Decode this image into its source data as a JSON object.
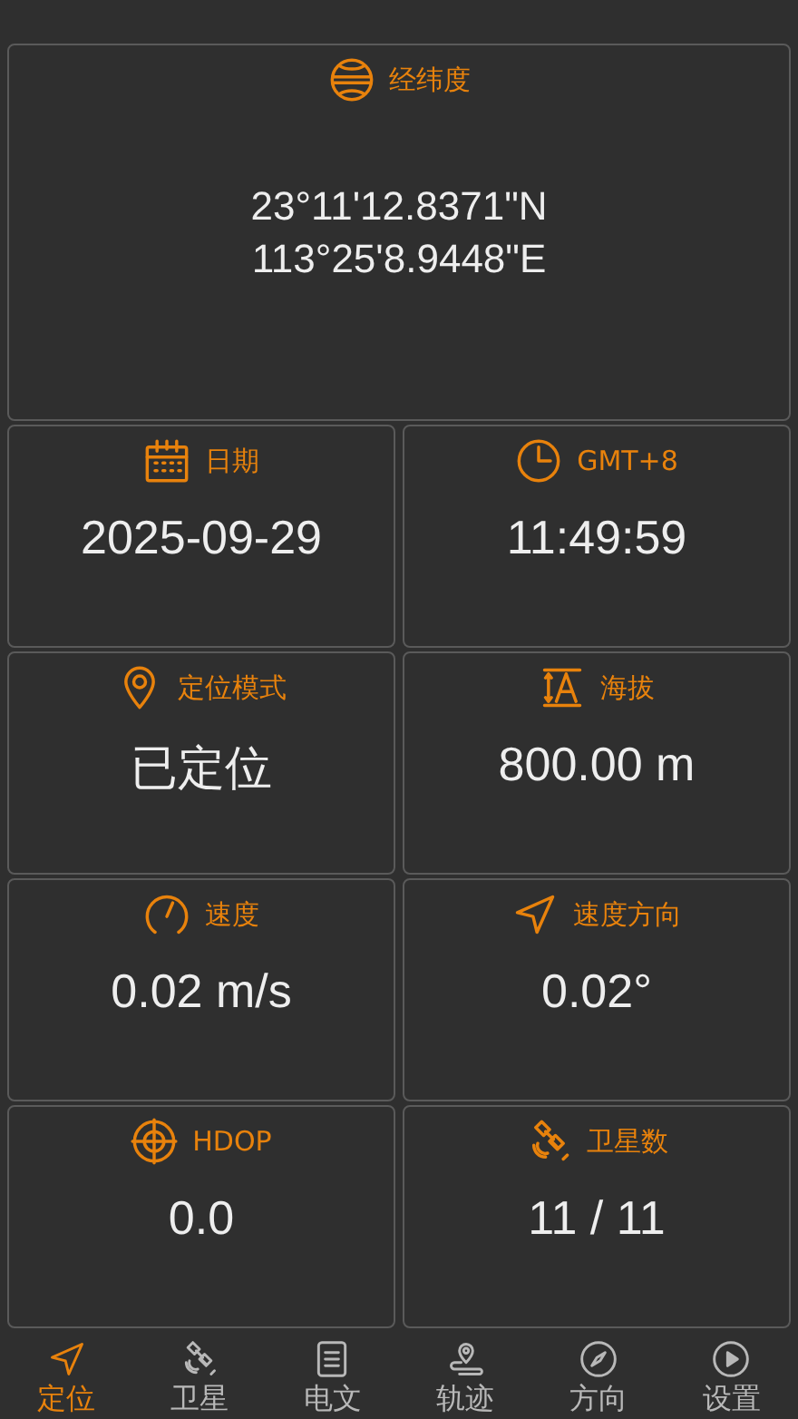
{
  "coordinates": {
    "kind": "globe",
    "label": "经纬度",
    "values": [
      "23°11'12.8371\"N",
      "113°25'8.9448\"E"
    ]
  },
  "cards": [
    {
      "kind": "calendar",
      "label": "日期",
      "value": "2025-09-29"
    },
    {
      "kind": "clock",
      "label": "GMT+8",
      "value": "11:49:59"
    },
    {
      "kind": "pin",
      "label": "定位模式",
      "value": "已定位"
    },
    {
      "kind": "altitude",
      "label": "海拔",
      "value": "800.00 m"
    },
    {
      "kind": "gauge",
      "label": "速度",
      "value": "0.02 m/s"
    },
    {
      "kind": "arrow",
      "label": "速度方向",
      "value": "0.02°"
    },
    {
      "kind": "target",
      "label": "HDOP",
      "value": "0.0"
    },
    {
      "kind": "satellite",
      "label": "卫星数",
      "value": "11 / 11"
    }
  ],
  "nav": [
    {
      "kind": "arrow",
      "label": "定位",
      "selected": true
    },
    {
      "kind": "satellite",
      "label": "卫星",
      "selected": false
    },
    {
      "kind": "document",
      "label": "电文",
      "selected": false
    },
    {
      "kind": "track",
      "label": "轨迹",
      "selected": false
    },
    {
      "kind": "compass",
      "label": "方向",
      "selected": false
    },
    {
      "kind": "play",
      "label": "设置",
      "selected": false
    }
  ]
}
